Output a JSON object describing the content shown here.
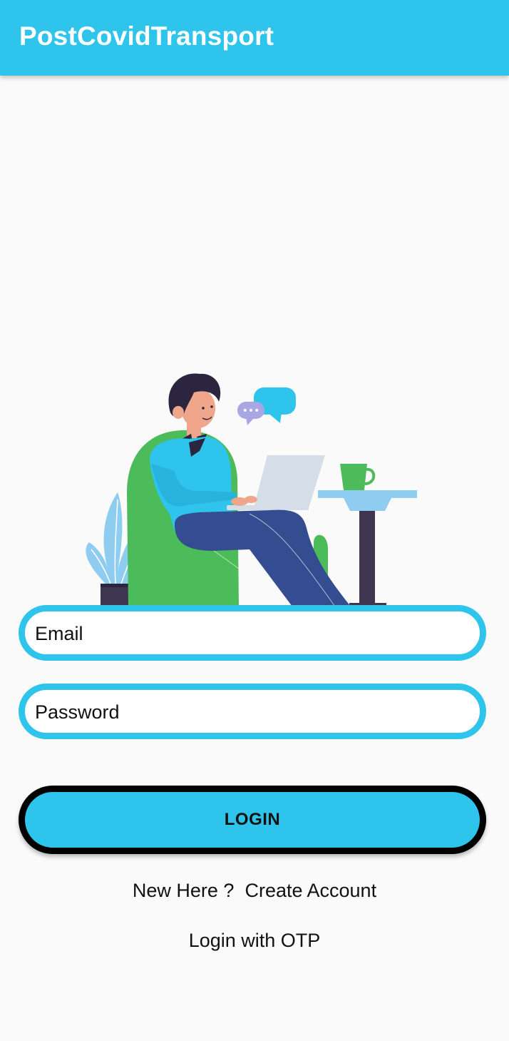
{
  "app_bar": {
    "title": "PostCovidTransport"
  },
  "login_form": {
    "email_placeholder": "Email",
    "password_placeholder": "Password",
    "login_button_label": "LOGIN"
  },
  "links": {
    "new_here": "New Here ?",
    "create_account": "Create Account",
    "login_with_otp": "Login with OTP"
  },
  "illustration": {
    "icon": "person-with-laptop-illustration",
    "speech_bubble_dots": "•••"
  },
  "colors": {
    "accent": "#2ec4ec",
    "background": "#fafafa",
    "button_border": "#000000",
    "armchair": "#4cbb5a",
    "jeans": "#344d91"
  }
}
